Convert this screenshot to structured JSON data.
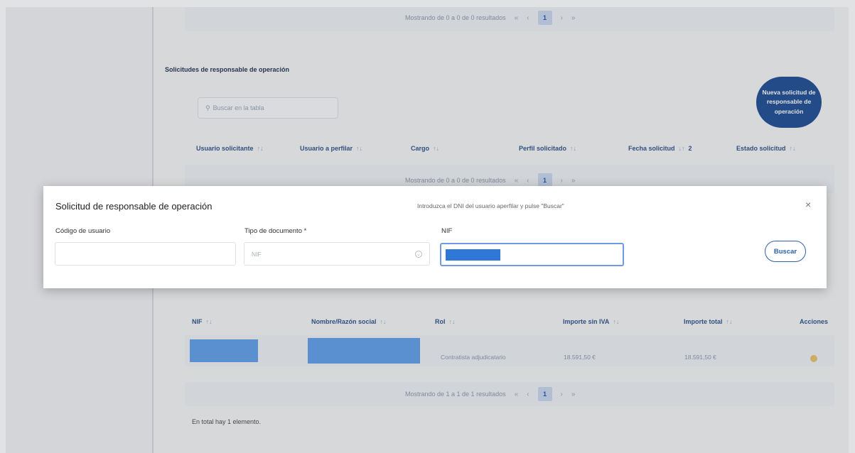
{
  "top_pager": {
    "text": "Mostrando de 0 a 0 de 0 resultados",
    "first": "«",
    "prev": "‹",
    "current": "1",
    "next": "›",
    "last": "»"
  },
  "section": {
    "title": "Solicitudes de responsable de operación",
    "search_placeholder": "Buscar en la tabla",
    "new_button": "Nueva solicitud de responsable de operación",
    "columns": [
      "Usuario solicitante",
      "Usuario a perfilar",
      "Cargo",
      "Perfil solicitado",
      "Fecha solicitud",
      "Estado solicitud"
    ],
    "fecha_sort_badge": "2",
    "sort_glyph": "↑↓",
    "pager": {
      "text": "Mostrando de 0 a 0 de 0 resultados",
      "first": "«",
      "prev": "‹",
      "current": "1",
      "next": "›",
      "last": "»"
    }
  },
  "contracts": {
    "columns": [
      "NIF",
      "Nombre/Razón social",
      "Rol",
      "Importe sin IVA",
      "Importe total",
      "Acciones"
    ],
    "rows": [
      {
        "rol": "Contratista adjudicatario",
        "importe_sin_iva": "18.591,50 €",
        "importe_total": "18.591,50 €"
      }
    ],
    "pager": {
      "text": "Mostrando de 1 a 1 de 1 resultados",
      "first": "«",
      "prev": "‹",
      "current": "1",
      "next": "›",
      "last": "»"
    },
    "footer": "En total hay 1 elemento."
  },
  "modal": {
    "title": "Solicitud de responsable de operación",
    "hint": "Introduzca el DNI del usuario aperfilar y pulse \"Buscar\"",
    "close": "×",
    "codigo_label": "Código de usuario",
    "codigo_value": "",
    "tipo_label": "Tipo de documento *",
    "tipo_value": "NIF",
    "nif_label": "NIF",
    "buscar": "Buscar"
  },
  "colors": {
    "primary": "#17478f",
    "redaction": "#5b9be8",
    "accent_border": "#6d9be3"
  },
  "icons": {
    "search": "search-icon",
    "close": "close-icon",
    "select": "chevron-down-icon",
    "action": "action-icon"
  }
}
